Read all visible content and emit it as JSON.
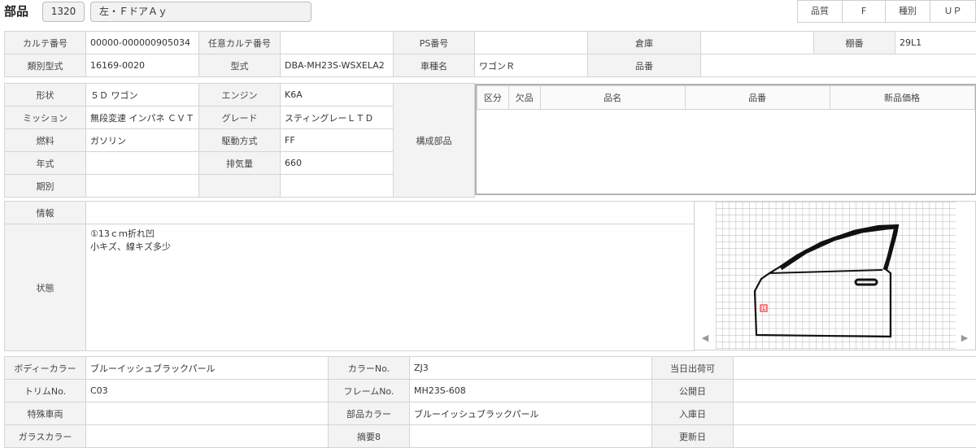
{
  "header": {
    "title": "部品",
    "part_code": "1320",
    "part_name": "左・ＦドアＡｙ",
    "quality_label": "品質",
    "quality_value": "F",
    "type_label": "種別",
    "type_value": "ＵＰ"
  },
  "karte": {
    "karte_no_label": "カルテ番号",
    "karte_no": "00000-000000905034",
    "opt_karte_label": "任意カルテ番号",
    "opt_karte": "",
    "ps_no_label": "PS番号",
    "ps_no": "",
    "warehouse_label": "倉庫",
    "warehouse": "",
    "shelf_label": "棚番",
    "shelf": "29L1",
    "class_model_label": "類別型式",
    "class_model": "16169-0020",
    "model_label": "型式",
    "model": "DBA-MH23S-WSXELA2",
    "car_name_label": "車種名",
    "car_name": "ワゴンＲ",
    "part_no_label": "品番",
    "part_no": ""
  },
  "specs": {
    "shape_label": "形状",
    "shape": "５Ｄ ワゴン",
    "engine_label": "エンジン",
    "engine": "K6A",
    "mission_label": "ミッション",
    "mission": "無段変速 インパネ ＣＶＴ",
    "grade_label": "グレード",
    "grade": "スティングレーＬＴＤ",
    "fuel_label": "燃料",
    "fuel": "ガソリン",
    "drive_label": "駆動方式",
    "drive": "FF",
    "year_label": "年式",
    "year": "",
    "displacement_label": "排気量",
    "displacement": "660",
    "period_label": "期別",
    "period": "",
    "components_label": "構成部品"
  },
  "components": {
    "headers": [
      "区分",
      "欠品",
      "品名",
      "品番",
      "新品価格"
    ]
  },
  "info": {
    "info_label": "情報",
    "info": "",
    "condition_label": "状態",
    "condition_line1": "①13ｃｍ折れ凹",
    "condition_line2": "小キズ、線キズ多少",
    "damage_marker": "①"
  },
  "colors": {
    "body_color_label": "ボディーカラー",
    "body_color": "ブルーイッシュブラックパール",
    "color_no_label": "カラーNo.",
    "color_no": "ZJ3",
    "same_day_label": "当日出荷可",
    "same_day": "",
    "trim_label": "トリムNo.",
    "trim": "C03",
    "frame_label": "フレームNo.",
    "frame": "MH23S-608",
    "public_label": "公開日",
    "public": "",
    "special_label": "特殊車両",
    "special": "",
    "part_color_label": "部品カラー",
    "part_color": "ブルーイッシュブラックパール",
    "arrival_label": "入庫日",
    "arrival": "",
    "glass_label": "ガラスカラー",
    "glass": "",
    "summary_label": "摘要8",
    "summary": "",
    "updated_label": "更新日",
    "updated": ""
  },
  "diagram": {
    "left_arrow": "◀",
    "right_arrow": "▶",
    "marker_color": "#ff0000"
  }
}
